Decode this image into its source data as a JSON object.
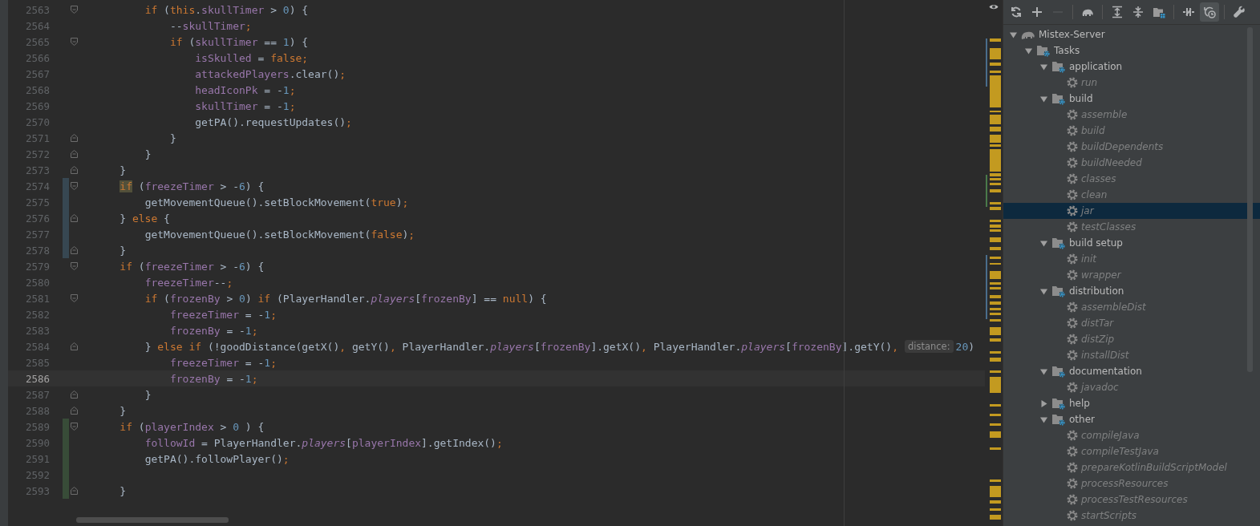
{
  "editor": {
    "lines": [
      {
        "number": "2563",
        "fold_start": true,
        "fold_end": false,
        "modified": false,
        "added": false,
        "current": false,
        "tokens": [
          {
            "kind": "keyword",
            "text": "        if"
          },
          {
            "kind": "plain",
            "text": " ("
          },
          {
            "kind": "keyword",
            "text": "this"
          },
          {
            "kind": "plain",
            "text": "."
          },
          {
            "kind": "field",
            "text": "skullTimer"
          },
          {
            "kind": "plain",
            "text": " > "
          },
          {
            "kind": "number",
            "text": "0"
          },
          {
            "kind": "plain",
            "text": ") {"
          }
        ]
      },
      {
        "number": "2564",
        "fold_start": false,
        "fold_end": false,
        "modified": false,
        "added": false,
        "current": false,
        "tokens": [
          {
            "kind": "plain",
            "text": "            --"
          },
          {
            "kind": "field",
            "text": "skullTimer"
          },
          {
            "kind": "keyword",
            "text": ";"
          }
        ]
      },
      {
        "number": "2565",
        "fold_start": true,
        "fold_end": false,
        "modified": false,
        "added": false,
        "current": false,
        "tokens": [
          {
            "kind": "keyword",
            "text": "            if"
          },
          {
            "kind": "plain",
            "text": " ("
          },
          {
            "kind": "field",
            "text": "skullTimer"
          },
          {
            "kind": "plain",
            "text": " == "
          },
          {
            "kind": "number",
            "text": "1"
          },
          {
            "kind": "plain",
            "text": ") {"
          }
        ]
      },
      {
        "number": "2566",
        "fold_start": false,
        "fold_end": false,
        "modified": false,
        "added": false,
        "current": false,
        "tokens": [
          {
            "kind": "field",
            "text": "                isSkulled"
          },
          {
            "kind": "plain",
            "text": " = "
          },
          {
            "kind": "keyword",
            "text": "false;"
          }
        ]
      },
      {
        "number": "2567",
        "fold_start": false,
        "fold_end": false,
        "modified": false,
        "added": false,
        "current": false,
        "tokens": [
          {
            "kind": "field",
            "text": "                attackedPlayers"
          },
          {
            "kind": "plain",
            "text": ".clear()"
          },
          {
            "kind": "keyword",
            "text": ";"
          }
        ]
      },
      {
        "number": "2568",
        "fold_start": false,
        "fold_end": false,
        "modified": false,
        "added": false,
        "current": false,
        "tokens": [
          {
            "kind": "field",
            "text": "                headIconPk"
          },
          {
            "kind": "plain",
            "text": " = -"
          },
          {
            "kind": "number",
            "text": "1"
          },
          {
            "kind": "keyword",
            "text": ";"
          }
        ]
      },
      {
        "number": "2569",
        "fold_start": false,
        "fold_end": false,
        "modified": false,
        "added": false,
        "current": false,
        "tokens": [
          {
            "kind": "field",
            "text": "                skullTimer"
          },
          {
            "kind": "plain",
            "text": " = -"
          },
          {
            "kind": "number",
            "text": "1"
          },
          {
            "kind": "keyword",
            "text": ";"
          }
        ]
      },
      {
        "number": "2570",
        "fold_start": false,
        "fold_end": false,
        "modified": false,
        "added": false,
        "current": false,
        "tokens": [
          {
            "kind": "plain",
            "text": "                getPA().requestUpdates()"
          },
          {
            "kind": "keyword",
            "text": ";"
          }
        ]
      },
      {
        "number": "2571",
        "fold_start": false,
        "fold_end": true,
        "modified": false,
        "added": false,
        "current": false,
        "tokens": [
          {
            "kind": "plain",
            "text": "            }"
          }
        ]
      },
      {
        "number": "2572",
        "fold_start": false,
        "fold_end": true,
        "modified": false,
        "added": false,
        "current": false,
        "tokens": [
          {
            "kind": "plain",
            "text": "        }"
          }
        ]
      },
      {
        "number": "2573",
        "fold_start": false,
        "fold_end": true,
        "modified": false,
        "added": false,
        "current": false,
        "tokens": [
          {
            "kind": "plain",
            "text": "    }"
          }
        ]
      },
      {
        "number": "2574",
        "fold_start": true,
        "fold_end": false,
        "modified": true,
        "added": false,
        "current": false,
        "tokens": [
          {
            "kind": "keyword-match",
            "text": "    if"
          },
          {
            "kind": "plain",
            "text": " ("
          },
          {
            "kind": "field",
            "text": "freezeTimer"
          },
          {
            "kind": "plain",
            "text": " > -"
          },
          {
            "kind": "number",
            "text": "6"
          },
          {
            "kind": "plain",
            "text": ") {"
          }
        ]
      },
      {
        "number": "2575",
        "fold_start": false,
        "fold_end": false,
        "modified": true,
        "added": false,
        "current": false,
        "tokens": [
          {
            "kind": "plain",
            "text": "        getMovementQueue().setBlockMovement("
          },
          {
            "kind": "keyword",
            "text": "true"
          },
          {
            "kind": "plain",
            "text": ")"
          },
          {
            "kind": "keyword",
            "text": ";"
          }
        ]
      },
      {
        "number": "2576",
        "fold_start": false,
        "fold_end": true,
        "modified": true,
        "added": false,
        "current": false,
        "tokens": [
          {
            "kind": "plain",
            "text": "    } "
          },
          {
            "kind": "keyword",
            "text": "else"
          },
          {
            "kind": "plain",
            "text": " {"
          }
        ]
      },
      {
        "number": "2577",
        "fold_start": false,
        "fold_end": false,
        "modified": true,
        "added": false,
        "current": false,
        "tokens": [
          {
            "kind": "plain",
            "text": "        getMovementQueue().setBlockMovement("
          },
          {
            "kind": "keyword",
            "text": "false"
          },
          {
            "kind": "plain",
            "text": ")"
          },
          {
            "kind": "keyword",
            "text": ";"
          }
        ]
      },
      {
        "number": "2578",
        "fold_start": false,
        "fold_end": true,
        "modified": true,
        "added": false,
        "current": false,
        "tokens": [
          {
            "kind": "plain",
            "text": "    }"
          }
        ]
      },
      {
        "number": "2579",
        "fold_start": true,
        "fold_end": false,
        "modified": false,
        "added": false,
        "current": false,
        "tokens": [
          {
            "kind": "keyword",
            "text": "    if"
          },
          {
            "kind": "plain",
            "text": " ("
          },
          {
            "kind": "field",
            "text": "freezeTimer"
          },
          {
            "kind": "plain",
            "text": " > -"
          },
          {
            "kind": "number",
            "text": "6"
          },
          {
            "kind": "plain",
            "text": ") {"
          }
        ]
      },
      {
        "number": "2580",
        "fold_start": false,
        "fold_end": false,
        "modified": false,
        "added": false,
        "current": false,
        "tokens": [
          {
            "kind": "field",
            "text": "        freezeTimer"
          },
          {
            "kind": "plain",
            "text": "--"
          },
          {
            "kind": "keyword",
            "text": ";"
          }
        ]
      },
      {
        "number": "2581",
        "fold_start": true,
        "fold_end": false,
        "modified": false,
        "added": false,
        "current": false,
        "tokens": [
          {
            "kind": "keyword",
            "text": "        if"
          },
          {
            "kind": "plain",
            "text": " ("
          },
          {
            "kind": "field",
            "text": "frozenBy"
          },
          {
            "kind": "plain",
            "text": " > "
          },
          {
            "kind": "number",
            "text": "0"
          },
          {
            "kind": "plain",
            "text": ") "
          },
          {
            "kind": "keyword",
            "text": "if"
          },
          {
            "kind": "plain",
            "text": " (PlayerHandler."
          },
          {
            "kind": "static",
            "text": "players"
          },
          {
            "kind": "plain",
            "text": "["
          },
          {
            "kind": "field",
            "text": "frozenBy"
          },
          {
            "kind": "plain",
            "text": "] == "
          },
          {
            "kind": "keyword",
            "text": "null"
          },
          {
            "kind": "plain",
            "text": ") {"
          }
        ]
      },
      {
        "number": "2582",
        "fold_start": false,
        "fold_end": false,
        "modified": false,
        "added": false,
        "current": false,
        "tokens": [
          {
            "kind": "field",
            "text": "            freezeTimer"
          },
          {
            "kind": "plain",
            "text": " = -"
          },
          {
            "kind": "number",
            "text": "1"
          },
          {
            "kind": "keyword",
            "text": ";"
          }
        ]
      },
      {
        "number": "2583",
        "fold_start": false,
        "fold_end": false,
        "modified": false,
        "added": false,
        "current": false,
        "tokens": [
          {
            "kind": "field",
            "text": "            frozenBy"
          },
          {
            "kind": "plain",
            "text": " = -"
          },
          {
            "kind": "number",
            "text": "1"
          },
          {
            "kind": "keyword",
            "text": ";"
          }
        ]
      },
      {
        "number": "2584",
        "fold_start": false,
        "fold_end": true,
        "modified": false,
        "added": false,
        "current": false,
        "tokens": [
          {
            "kind": "plain",
            "text": "        } "
          },
          {
            "kind": "keyword",
            "text": "else if"
          },
          {
            "kind": "plain",
            "text": " (!goodDistance(getX()"
          },
          {
            "kind": "keyword",
            "text": ","
          },
          {
            "kind": "plain",
            "text": " getY()"
          },
          {
            "kind": "keyword",
            "text": ","
          },
          {
            "kind": "plain",
            "text": " PlayerHandler."
          },
          {
            "kind": "static",
            "text": "players"
          },
          {
            "kind": "plain",
            "text": "["
          },
          {
            "kind": "field",
            "text": "frozenBy"
          },
          {
            "kind": "plain",
            "text": "].getX()"
          },
          {
            "kind": "keyword",
            "text": ","
          },
          {
            "kind": "plain",
            "text": " PlayerHandler."
          },
          {
            "kind": "static",
            "text": "players"
          },
          {
            "kind": "plain",
            "text": "["
          },
          {
            "kind": "field",
            "text": "frozenBy"
          },
          {
            "kind": "plain",
            "text": "].getY()"
          },
          {
            "kind": "keyword",
            "text": ","
          },
          {
            "kind": "hint",
            "text": "distance:"
          },
          {
            "kind": "number",
            "text": "20"
          },
          {
            "kind": "plain",
            "text": ")"
          }
        ]
      },
      {
        "number": "2585",
        "fold_start": false,
        "fold_end": false,
        "modified": false,
        "added": false,
        "current": false,
        "tokens": [
          {
            "kind": "field",
            "text": "            freezeTimer"
          },
          {
            "kind": "plain",
            "text": " = -"
          },
          {
            "kind": "number",
            "text": "1"
          },
          {
            "kind": "keyword",
            "text": ";"
          }
        ]
      },
      {
        "number": "2586",
        "fold_start": false,
        "fold_end": false,
        "modified": false,
        "added": false,
        "current": true,
        "tokens": [
          {
            "kind": "field",
            "text": "            frozenBy"
          },
          {
            "kind": "plain",
            "text": " = -"
          },
          {
            "kind": "number",
            "text": "1"
          },
          {
            "kind": "keyword",
            "text": ";"
          }
        ]
      },
      {
        "number": "2587",
        "fold_start": false,
        "fold_end": true,
        "modified": false,
        "added": false,
        "current": false,
        "tokens": [
          {
            "kind": "plain",
            "text": "        }"
          }
        ]
      },
      {
        "number": "2588",
        "fold_start": false,
        "fold_end": true,
        "modified": false,
        "added": false,
        "current": false,
        "tokens": [
          {
            "kind": "plain",
            "text": "    }"
          }
        ]
      },
      {
        "number": "2589",
        "fold_start": true,
        "fold_end": false,
        "modified": false,
        "added": true,
        "current": false,
        "tokens": [
          {
            "kind": "keyword",
            "text": "    if"
          },
          {
            "kind": "plain",
            "text": " ("
          },
          {
            "kind": "field",
            "text": "playerIndex"
          },
          {
            "kind": "plain",
            "text": " > "
          },
          {
            "kind": "number",
            "text": "0"
          },
          {
            "kind": "plain",
            "text": " ) {"
          }
        ]
      },
      {
        "number": "2590",
        "fold_start": false,
        "fold_end": false,
        "modified": false,
        "added": true,
        "current": false,
        "tokens": [
          {
            "kind": "field",
            "text": "        followId"
          },
          {
            "kind": "plain",
            "text": " = PlayerHandler."
          },
          {
            "kind": "static",
            "text": "players"
          },
          {
            "kind": "plain",
            "text": "["
          },
          {
            "kind": "field",
            "text": "playerIndex"
          },
          {
            "kind": "plain",
            "text": "].getIndex()"
          },
          {
            "kind": "keyword",
            "text": ";"
          }
        ]
      },
      {
        "number": "2591",
        "fold_start": false,
        "fold_end": false,
        "modified": false,
        "added": true,
        "current": false,
        "tokens": [
          {
            "kind": "plain",
            "text": "        getPA().followPlayer()"
          },
          {
            "kind": "keyword",
            "text": ";"
          }
        ]
      },
      {
        "number": "2592",
        "fold_start": false,
        "fold_end": false,
        "modified": false,
        "added": true,
        "current": false
      },
      {
        "number": "2593",
        "fold_start": false,
        "fold_end": true,
        "modified": false,
        "added": true,
        "current": false,
        "tokens": [
          {
            "kind": "plain",
            "text": "    }"
          }
        ]
      }
    ]
  },
  "gradle_panel": {
    "toolbar": [
      {
        "kind": "refresh",
        "disabled": false,
        "selected": false
      },
      {
        "kind": "add",
        "disabled": false,
        "selected": false
      },
      {
        "kind": "remove",
        "disabled": true,
        "selected": false
      },
      {
        "kind": "separator"
      },
      {
        "kind": "elephant",
        "disabled": false,
        "selected": false
      },
      {
        "kind": "separator"
      },
      {
        "kind": "expand-all",
        "disabled": false,
        "selected": false
      },
      {
        "kind": "collapse-all",
        "disabled": false,
        "selected": false
      },
      {
        "kind": "folder-grid",
        "disabled": false,
        "selected": false
      },
      {
        "kind": "separator"
      },
      {
        "kind": "toggle-offline",
        "disabled": false,
        "selected": false
      },
      {
        "kind": "history",
        "disabled": false,
        "selected": true
      },
      {
        "kind": "separator"
      },
      {
        "kind": "wrench",
        "disabled": false,
        "selected": false
      }
    ],
    "tree": [
      {
        "label": "Mistex-Server",
        "kind": "project",
        "expanded": true,
        "selected": false,
        "children": [
          {
            "label": "Tasks",
            "kind": "folder",
            "expanded": true,
            "selected": false,
            "children": [
              {
                "label": "application",
                "kind": "folder",
                "expanded": true,
                "selected": false,
                "children": [
                  {
                    "label": "run",
                    "kind": "task",
                    "selected": false
                  }
                ]
              },
              {
                "label": "build",
                "kind": "folder",
                "expanded": true,
                "selected": false,
                "children": [
                  {
                    "label": "assemble",
                    "kind": "task",
                    "selected": false
                  },
                  {
                    "label": "build",
                    "kind": "task",
                    "selected": false
                  },
                  {
                    "label": "buildDependents",
                    "kind": "task",
                    "selected": false
                  },
                  {
                    "label": "buildNeeded",
                    "kind": "task",
                    "selected": false
                  },
                  {
                    "label": "classes",
                    "kind": "task",
                    "selected": false
                  },
                  {
                    "label": "clean",
                    "kind": "task",
                    "selected": false
                  },
                  {
                    "label": "jar",
                    "kind": "task",
                    "selected": true
                  },
                  {
                    "label": "testClasses",
                    "kind": "task",
                    "selected": false
                  }
                ]
              },
              {
                "label": "build setup",
                "kind": "folder",
                "expanded": true,
                "selected": false,
                "children": [
                  {
                    "label": "init",
                    "kind": "task",
                    "selected": false
                  },
                  {
                    "label": "wrapper",
                    "kind": "task",
                    "selected": false
                  }
                ]
              },
              {
                "label": "distribution",
                "kind": "folder",
                "expanded": true,
                "selected": false,
                "children": [
                  {
                    "label": "assembleDist",
                    "kind": "task",
                    "selected": false
                  },
                  {
                    "label": "distTar",
                    "kind": "task",
                    "selected": false
                  },
                  {
                    "label": "distZip",
                    "kind": "task",
                    "selected": false
                  },
                  {
                    "label": "installDist",
                    "kind": "task",
                    "selected": false
                  }
                ]
              },
              {
                "label": "documentation",
                "kind": "folder",
                "expanded": true,
                "selected": false,
                "children": [
                  {
                    "label": "javadoc",
                    "kind": "task",
                    "selected": false
                  }
                ]
              },
              {
                "label": "help",
                "kind": "folder",
                "expanded": false,
                "selected": false
              },
              {
                "label": "other",
                "kind": "folder",
                "expanded": true,
                "selected": false,
                "children": [
                  {
                    "label": "compileJava",
                    "kind": "task",
                    "selected": false
                  },
                  {
                    "label": "compileTestJava",
                    "kind": "task",
                    "selected": false
                  },
                  {
                    "label": "prepareKotlinBuildScriptModel",
                    "kind": "task",
                    "selected": false
                  },
                  {
                    "label": "processResources",
                    "kind": "task",
                    "selected": false
                  },
                  {
                    "label": "processTestResources",
                    "kind": "task",
                    "selected": false
                  },
                  {
                    "label": "startScripts",
                    "kind": "task",
                    "selected": false
                  }
                ]
              }
            ]
          }
        ]
      }
    ]
  }
}
